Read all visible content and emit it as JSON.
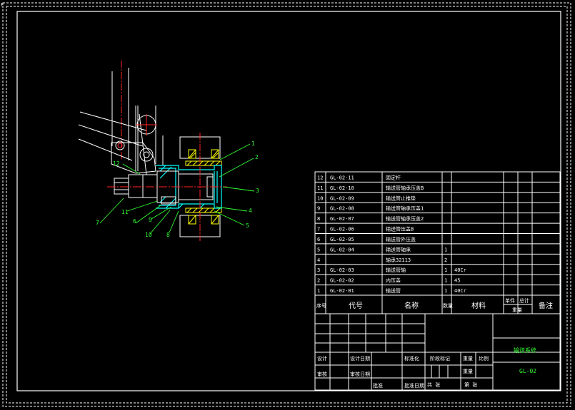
{
  "sheet": {
    "corner_mark": "F"
  },
  "balloons": [
    "1",
    "2",
    "3",
    "4",
    "5",
    "6",
    "7",
    "8",
    "9",
    "10",
    "11",
    "12"
  ],
  "bom": {
    "headers": {
      "seq": "序号",
      "code": "代号",
      "name": "名称",
      "qty": "数量",
      "material": "材料",
      "single": "单件",
      "total": "总计",
      "weight": "重量",
      "remark": "备注"
    },
    "rows": [
      {
        "seq": "12",
        "code": "GL-02-11",
        "name": "固定杆",
        "qty": "",
        "material": ""
      },
      {
        "seq": "11",
        "code": "GL-02-10",
        "name": "输送管轴承压盖B",
        "qty": "",
        "material": ""
      },
      {
        "seq": "10",
        "code": "GL-02-09",
        "name": "输送管止推垫",
        "qty": "",
        "material": ""
      },
      {
        "seq": "9",
        "code": "GL-02-08",
        "name": "输送管轴承压盖1",
        "qty": "",
        "material": ""
      },
      {
        "seq": "8",
        "code": "GL-02-07",
        "name": "输送管轴承压盖2",
        "qty": "",
        "material": ""
      },
      {
        "seq": "7",
        "code": "GL-02-06",
        "name": "输送管压盖B",
        "qty": "",
        "material": ""
      },
      {
        "seq": "6",
        "code": "GL-02-05",
        "name": "输送管外压盖",
        "qty": "",
        "material": ""
      },
      {
        "seq": "5",
        "code": "GL-02-04",
        "name": "输送管轴承",
        "qty": "1",
        "material": ""
      },
      {
        "seq": "4",
        "code": "",
        "name": "轴承32113",
        "qty": "2",
        "material": ""
      },
      {
        "seq": "3",
        "code": "GL-02-03",
        "name": "输送管轴",
        "qty": "1",
        "material": "40Cr"
      },
      {
        "seq": "2",
        "code": "GL-02-02",
        "name": "内压盖",
        "qty": "1",
        "material": "45"
      },
      {
        "seq": "1",
        "code": "GL-02-01",
        "name": "输送管",
        "qty": "1",
        "material": "40Cr"
      }
    ]
  },
  "title_block": {
    "design": "设计",
    "design_date": "设计日期",
    "standardization": "标准化",
    "check": "审核",
    "check_date": "审核日期",
    "approve": "批准",
    "approve_date": "批准日期",
    "stage_mark": "阶段标记",
    "weight": "重量",
    "scale": "比例",
    "sheet_total": "共 张",
    "sheet_no": "第 张",
    "drawing_name": "输送系统",
    "drawing_code": "GL-02"
  },
  "colors": {
    "outline": "#ffffff",
    "centerline": "#ff2222",
    "hatch": "#ffff00",
    "section": "#00ffff",
    "leader": "#33ff33"
  }
}
